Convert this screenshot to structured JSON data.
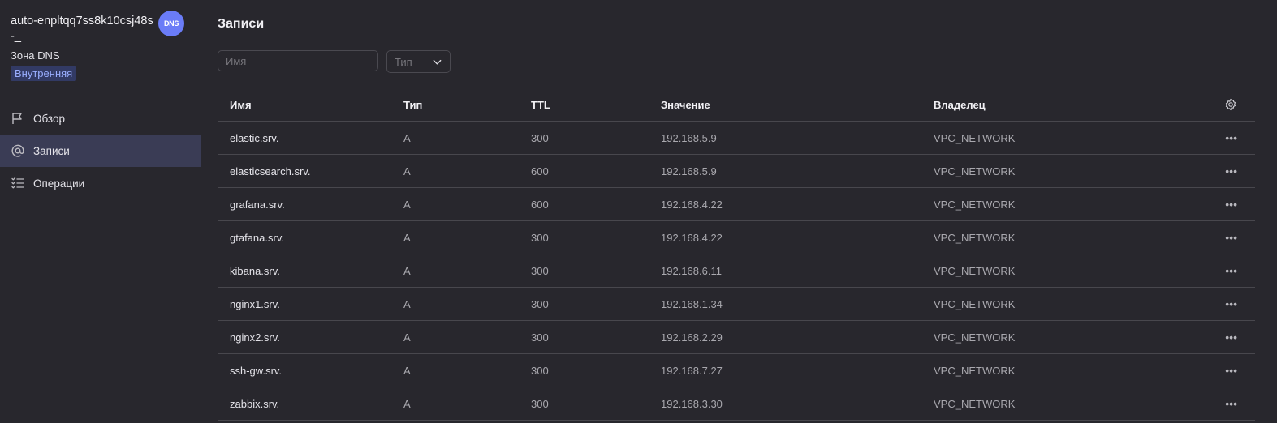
{
  "zone": {
    "name": "auto-enpltqq7ss8k10csj48s-_",
    "subtitle": "Зона DNS",
    "badge": "Внутренняя",
    "icon_label": "DNS",
    "icon_color": "#6a7cf7"
  },
  "sidebar": {
    "items": [
      {
        "label": "Обзор",
        "icon": "flag-icon",
        "active": false
      },
      {
        "label": "Записи",
        "icon": "at-icon",
        "active": true
      },
      {
        "label": "Операции",
        "icon": "checklist-icon",
        "active": false
      }
    ]
  },
  "main": {
    "title": "Записи",
    "filters": {
      "name_placeholder": "Имя",
      "type_placeholder": "Тип"
    },
    "table": {
      "headers": {
        "name": "Имя",
        "type": "Тип",
        "ttl": "TTL",
        "value": "Значение",
        "owner": "Владелец"
      },
      "rows": [
        {
          "name": "elastic.srv.",
          "type": "A",
          "ttl": "300",
          "value": "192.168.5.9",
          "owner": "VPC_NETWORK"
        },
        {
          "name": "elasticsearch.srv.",
          "type": "A",
          "ttl": "600",
          "value": "192.168.5.9",
          "owner": "VPC_NETWORK"
        },
        {
          "name": "grafana.srv.",
          "type": "A",
          "ttl": "600",
          "value": "192.168.4.22",
          "owner": "VPC_NETWORK"
        },
        {
          "name": "gtafana.srv.",
          "type": "A",
          "ttl": "300",
          "value": "192.168.4.22",
          "owner": "VPC_NETWORK"
        },
        {
          "name": "kibana.srv.",
          "type": "A",
          "ttl": "300",
          "value": "192.168.6.11",
          "owner": "VPC_NETWORK"
        },
        {
          "name": "nginx1.srv.",
          "type": "A",
          "ttl": "300",
          "value": "192.168.1.34",
          "owner": "VPC_NETWORK"
        },
        {
          "name": "nginx2.srv.",
          "type": "A",
          "ttl": "300",
          "value": "192.168.2.29",
          "owner": "VPC_NETWORK"
        },
        {
          "name": "ssh-gw.srv.",
          "type": "A",
          "ttl": "300",
          "value": "192.168.7.27",
          "owner": "VPC_NETWORK"
        },
        {
          "name": "zabbix.srv.",
          "type": "A",
          "ttl": "300",
          "value": "192.168.3.30",
          "owner": "VPC_NETWORK"
        }
      ]
    }
  }
}
